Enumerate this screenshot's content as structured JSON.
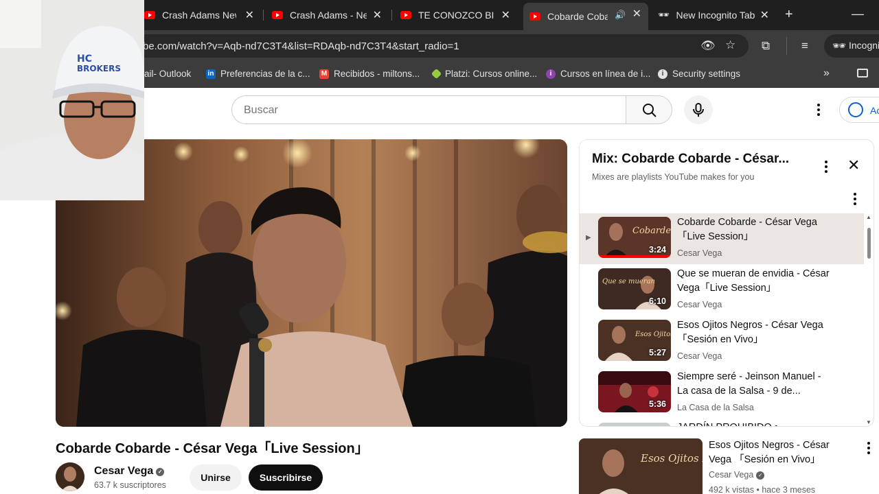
{
  "browser": {
    "tabs": [
      {
        "title": "Crash Adams New I"
      },
      {
        "title": "Crash Adams - New"
      },
      {
        "title": "TE CONOZCO BIEN"
      },
      {
        "title": "Cobarde Cobarde"
      },
      {
        "title": "New Incognito Tab"
      }
    ],
    "url": "be.com/watch?v=Aqb-nd7C3T4&list=RDAqb-nd7C3T4&start_radio=1",
    "incognito_label": "Incogni",
    "bookmarks": [
      {
        "label": "ail- Outlook"
      },
      {
        "label": "Preferencias de la c..."
      },
      {
        "label": "Recibidos - miltons..."
      },
      {
        "label": "Platzi: Cursos online..."
      },
      {
        "label": "Cursos en línea de i..."
      },
      {
        "label": "Security settings"
      }
    ]
  },
  "header": {
    "search_placeholder": "Buscar",
    "signin_label": "Ac"
  },
  "video": {
    "title": "Cobarde Cobarde - César Vega「Live Session」",
    "channel": "Cesar Vega",
    "subscribers": "63.7 k suscriptores",
    "join_label": "Unirse",
    "subscribe_label": "Suscribirse"
  },
  "playlist": {
    "title": "Mix: Cobarde Cobarde - César...",
    "subtitle": "Mixes are playlists YouTube makes for you",
    "items": [
      {
        "title": "Cobarde Cobarde - César Vega 「Live Session」",
        "channel": "Cesar Vega",
        "duration": "3:24"
      },
      {
        "title": "Que se mueran de envidia - César Vega「Live Session」",
        "channel": "Cesar Vega",
        "duration": "6:10"
      },
      {
        "title": "Esos Ojitos Negros - César Vega「Sesión en Vivo」",
        "channel": "Cesar Vega",
        "duration": "5:27"
      },
      {
        "title": "Siempre seré - Jeinson Manuel - La casa de la Salsa - 9 de...",
        "channel": "La Casa de la Salsa",
        "duration": "5:36"
      },
      {
        "title": "JARDÍN PROHIBIDO •",
        "channel": "",
        "duration": ""
      }
    ]
  },
  "recommended": {
    "title": "Esos Ojitos Negros - César Vega 「Sesión en Vivo」",
    "channel": "Cesar Vega",
    "meta": "492 k vistas • hace 3 meses",
    "thumb_text": "Esos Ojitos Negros"
  },
  "colors": {
    "chrome_dark": "#1f1f1f",
    "chrome_bar": "#3c3c3c",
    "youtube_red": "#ff0000",
    "link_blue": "#065fd4",
    "current_item_bg": "#ece6e3"
  }
}
